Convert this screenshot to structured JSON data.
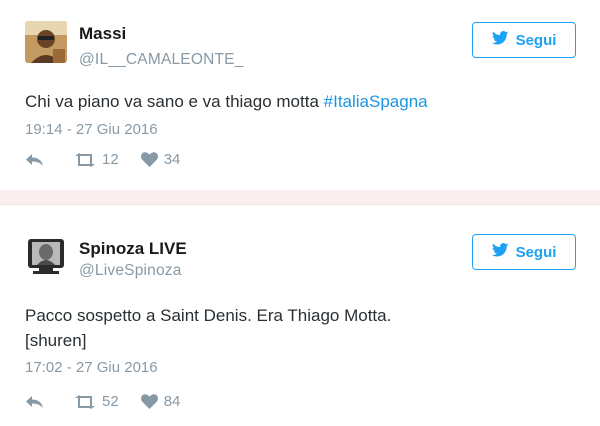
{
  "colors": {
    "accent": "#1da1f2",
    "hashtag": "#1b95e0",
    "muted": "#8899a6",
    "text": "#292f33"
  },
  "tweets": [
    {
      "name": "Massi",
      "handle": "@IL__CAMALEONTE_",
      "follow_label": "Segui",
      "text": "Chi va piano va sano e va thiago motta ",
      "hashtag": "#ItaliaSpagna",
      "time": "19:14 - 27 Giu 2016",
      "retweets": "12",
      "likes": "34"
    },
    {
      "name": "Spinoza LIVE",
      "handle": "@LiveSpinoza",
      "follow_label": "Segui",
      "text_line1": "Pacco sospetto a Saint Denis. Era Thiago Motta.",
      "text_line2": "[shuren]",
      "time": "17:02 - 27 Giu 2016",
      "retweets": "52",
      "likes": "84"
    }
  ],
  "icons": {
    "follow": "twitter-bird-icon",
    "reply": "reply-icon",
    "retweet": "retweet-icon",
    "like": "heart-icon"
  }
}
